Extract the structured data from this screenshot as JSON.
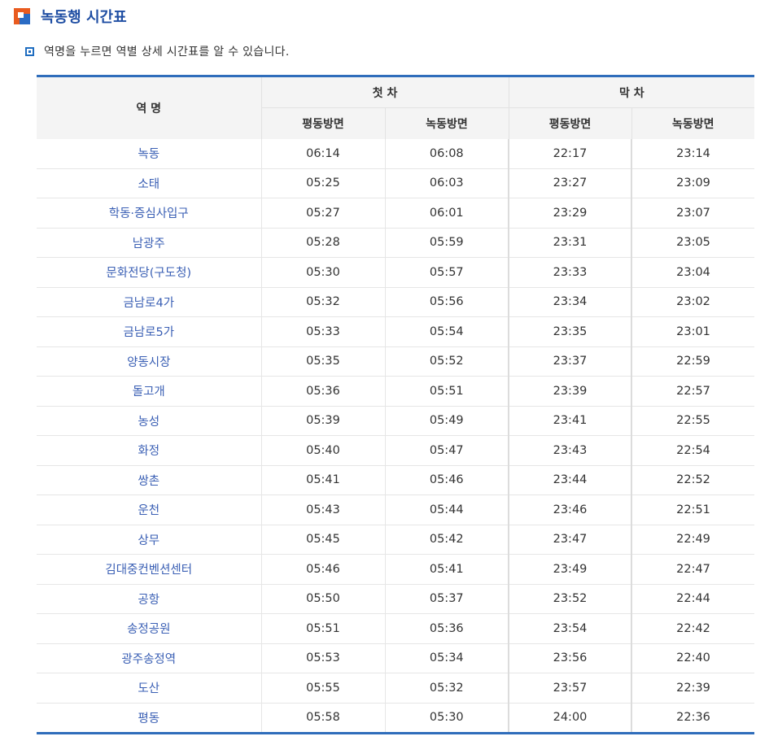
{
  "title": "녹동행 시간표",
  "note": "역명을 누르면 역별 상세 시간표를 알 수 있습니다.",
  "icons": {
    "title": "square-marker-icon",
    "note": "square-bullet-icon"
  },
  "colors": {
    "title": "#1f4ea3",
    "station_link": "#3a5fb4",
    "table_rule": "#2f6dbb",
    "marker_orange": "#e95b1f"
  },
  "header": {
    "station": "역 명",
    "first": "첫 차",
    "last": "막 차",
    "dir_a": "평동방면",
    "dir_b": "녹동방면"
  },
  "rows": [
    {
      "station": "녹동",
      "first_a": "06:14",
      "first_b": "06:08",
      "last_a": "22:17",
      "last_b": "23:14"
    },
    {
      "station": "소태",
      "first_a": "05:25",
      "first_b": "06:03",
      "last_a": "23:27",
      "last_b": "23:09"
    },
    {
      "station": "학동·증심사입구",
      "first_a": "05:27",
      "first_b": "06:01",
      "last_a": "23:29",
      "last_b": "23:07"
    },
    {
      "station": "남광주",
      "first_a": "05:28",
      "first_b": "05:59",
      "last_a": "23:31",
      "last_b": "23:05"
    },
    {
      "station": "문화전당(구도청)",
      "first_a": "05:30",
      "first_b": "05:57",
      "last_a": "23:33",
      "last_b": "23:04"
    },
    {
      "station": "금남로4가",
      "first_a": "05:32",
      "first_b": "05:56",
      "last_a": "23:34",
      "last_b": "23:02"
    },
    {
      "station": "금남로5가",
      "first_a": "05:33",
      "first_b": "05:54",
      "last_a": "23:35",
      "last_b": "23:01"
    },
    {
      "station": "양동시장",
      "first_a": "05:35",
      "first_b": "05:52",
      "last_a": "23:37",
      "last_b": "22:59"
    },
    {
      "station": "돌고개",
      "first_a": "05:36",
      "first_b": "05:51",
      "last_a": "23:39",
      "last_b": "22:57"
    },
    {
      "station": "농성",
      "first_a": "05:39",
      "first_b": "05:49",
      "last_a": "23:41",
      "last_b": "22:55"
    },
    {
      "station": "화정",
      "first_a": "05:40",
      "first_b": "05:47",
      "last_a": "23:43",
      "last_b": "22:54"
    },
    {
      "station": "쌍촌",
      "first_a": "05:41",
      "first_b": "05:46",
      "last_a": "23:44",
      "last_b": "22:52"
    },
    {
      "station": "운천",
      "first_a": "05:43",
      "first_b": "05:44",
      "last_a": "23:46",
      "last_b": "22:51"
    },
    {
      "station": "상무",
      "first_a": "05:45",
      "first_b": "05:42",
      "last_a": "23:47",
      "last_b": "22:49"
    },
    {
      "station": "김대중컨벤션센터",
      "first_a": "05:46",
      "first_b": "05:41",
      "last_a": "23:49",
      "last_b": "22:47"
    },
    {
      "station": "공항",
      "first_a": "05:50",
      "first_b": "05:37",
      "last_a": "23:52",
      "last_b": "22:44"
    },
    {
      "station": "송정공원",
      "first_a": "05:51",
      "first_b": "05:36",
      "last_a": "23:54",
      "last_b": "22:42"
    },
    {
      "station": "광주송정역",
      "first_a": "05:53",
      "first_b": "05:34",
      "last_a": "23:56",
      "last_b": "22:40"
    },
    {
      "station": "도산",
      "first_a": "05:55",
      "first_b": "05:32",
      "last_a": "23:57",
      "last_b": "22:39"
    },
    {
      "station": "평동",
      "first_a": "05:58",
      "first_b": "05:30",
      "last_a": "24:00",
      "last_b": "22:36"
    }
  ]
}
